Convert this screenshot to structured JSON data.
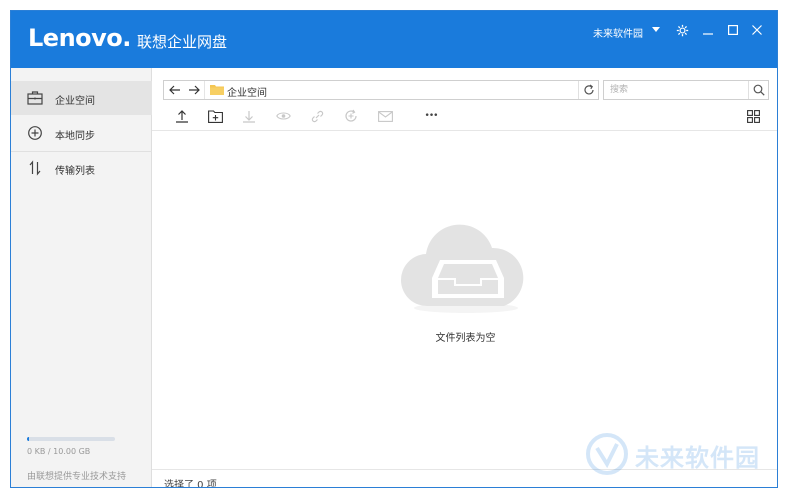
{
  "titlebar": {
    "logo_text": "Lenovo",
    "logo_dot": ".",
    "app_title": "联想企业网盘",
    "user_name": "未来软件园"
  },
  "sidebar": {
    "items": [
      {
        "label": "企业空间",
        "icon": "briefcase-icon"
      },
      {
        "label": "本地同步",
        "icon": "sync-icon"
      },
      {
        "label": "传输列表",
        "icon": "transfer-icon"
      }
    ],
    "quota_text": "0 KB / 10.00 GB",
    "quota_used_fraction": 0.02,
    "support_text": "由联想提供专业技术支持"
  },
  "address_bar": {
    "path": "企业空间"
  },
  "search": {
    "placeholder": "搜索"
  },
  "toolbar": {
    "more_label": "•••"
  },
  "empty_state": {
    "message": "文件列表为空"
  },
  "status_bar": {
    "text": "选择了 0 项"
  },
  "watermark": {
    "text": "未来软件园"
  },
  "colors": {
    "brand": "#1a7bdc",
    "sidebar_bg": "#f3f3f3",
    "active_item_bg": "#e4e4e4",
    "cloud_gray": "#e3e3e3"
  }
}
